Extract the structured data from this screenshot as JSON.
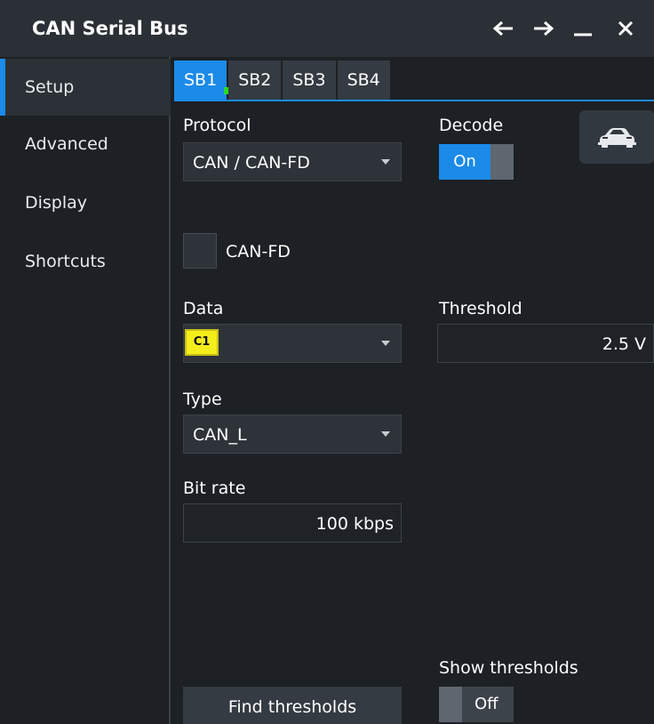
{
  "window": {
    "title": "CAN Serial Bus",
    "back_icon": "arrow-left-icon",
    "forward_icon": "arrow-right-icon",
    "minimize_icon": "minimize-icon",
    "close_icon": "close-icon"
  },
  "sidebar": {
    "items": [
      {
        "label": "Setup",
        "active": true
      },
      {
        "label": "Advanced",
        "active": false
      },
      {
        "label": "Display",
        "active": false
      },
      {
        "label": "Shortcuts",
        "active": false
      }
    ]
  },
  "tabs": [
    {
      "label": "SB1",
      "active": true,
      "indicator": "green-dot"
    },
    {
      "label": "SB2",
      "active": false
    },
    {
      "label": "SB3",
      "active": false
    },
    {
      "label": "SB4",
      "active": false
    }
  ],
  "setup": {
    "protocol_label": "Protocol",
    "protocol_value": "CAN / CAN-FD",
    "decode_label": "Decode",
    "decode_state": "On",
    "car_icon": "car-icon",
    "canfd_label": "CAN-FD",
    "canfd_checked": false,
    "data_label": "Data",
    "data_source": "C1",
    "threshold_label": "Threshold",
    "threshold_value": "2.5 V",
    "type_label": "Type",
    "type_value": "CAN_L",
    "bitrate_label": "Bit rate",
    "bitrate_value": "100 kbps",
    "show_thresholds_label": "Show thresholds",
    "show_thresholds_state": "Off",
    "find_thresholds_label": "Find thresholds"
  },
  "colors": {
    "accent": "#1b8ae8",
    "channel_c1": "#f4ed1c",
    "indicator": "#2bd82b",
    "background": "#1d2024",
    "titlebar": "#2b3036"
  }
}
